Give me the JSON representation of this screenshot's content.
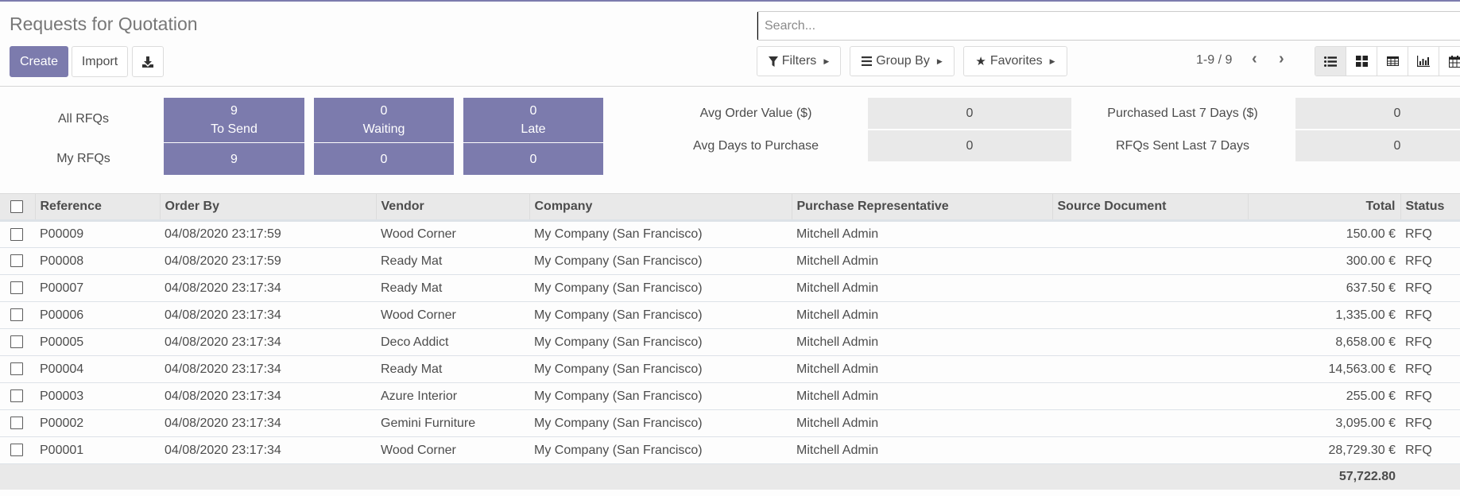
{
  "page": {
    "title": "Requests for Quotation",
    "accent_color": "#7c7bad"
  },
  "toolbar": {
    "create_label": "Create",
    "import_label": "Import",
    "download_icon": "download-icon"
  },
  "search": {
    "placeholder": "Search...",
    "value": ""
  },
  "filters": {
    "filters_label": "Filters",
    "group_by_label": "Group By",
    "favorites_label": "Favorites"
  },
  "pager": {
    "text": "1-9 / 9"
  },
  "views": [
    "list",
    "kanban",
    "pivot",
    "graph",
    "calendar"
  ],
  "dashboard": {
    "row_labels": [
      "All RFQs",
      "My RFQs"
    ],
    "tiles": [
      {
        "all_count": "9",
        "label": "To Send",
        "my_count": "9"
      },
      {
        "all_count": "0",
        "label": "Waiting",
        "my_count": "0"
      },
      {
        "all_count": "0",
        "label": "Late",
        "my_count": "0"
      }
    ],
    "stats": [
      {
        "label": "Avg Order Value ($)",
        "value": "0"
      },
      {
        "label": "Avg Days to Purchase",
        "value": "0"
      },
      {
        "label": "Purchased Last 7 Days ($)",
        "value": "0"
      },
      {
        "label": "RFQs Sent Last 7 Days",
        "value": "0"
      }
    ]
  },
  "table": {
    "columns": [
      "Reference",
      "Order By",
      "Vendor",
      "Company",
      "Purchase Representative",
      "Source Document",
      "Total",
      "Status"
    ],
    "rows": [
      {
        "reference": "P00009",
        "order_by": "04/08/2020 23:17:59",
        "vendor": "Wood Corner",
        "company": "My Company (San Francisco)",
        "rep": "Mitchell Admin",
        "source": "",
        "total": "150.00 €",
        "status": "RFQ"
      },
      {
        "reference": "P00008",
        "order_by": "04/08/2020 23:17:59",
        "vendor": "Ready Mat",
        "company": "My Company (San Francisco)",
        "rep": "Mitchell Admin",
        "source": "",
        "total": "300.00 €",
        "status": "RFQ"
      },
      {
        "reference": "P00007",
        "order_by": "04/08/2020 23:17:34",
        "vendor": "Ready Mat",
        "company": "My Company (San Francisco)",
        "rep": "Mitchell Admin",
        "source": "",
        "total": "637.50 €",
        "status": "RFQ"
      },
      {
        "reference": "P00006",
        "order_by": "04/08/2020 23:17:34",
        "vendor": "Wood Corner",
        "company": "My Company (San Francisco)",
        "rep": "Mitchell Admin",
        "source": "",
        "total": "1,335.00 €",
        "status": "RFQ"
      },
      {
        "reference": "P00005",
        "order_by": "04/08/2020 23:17:34",
        "vendor": "Deco Addict",
        "company": "My Company (San Francisco)",
        "rep": "Mitchell Admin",
        "source": "",
        "total": "8,658.00 €",
        "status": "RFQ"
      },
      {
        "reference": "P00004",
        "order_by": "04/08/2020 23:17:34",
        "vendor": "Ready Mat",
        "company": "My Company (San Francisco)",
        "rep": "Mitchell Admin",
        "source": "",
        "total": "14,563.00 €",
        "status": "RFQ"
      },
      {
        "reference": "P00003",
        "order_by": "04/08/2020 23:17:34",
        "vendor": "Azure Interior",
        "company": "My Company (San Francisco)",
        "rep": "Mitchell Admin",
        "source": "",
        "total": "255.00 €",
        "status": "RFQ"
      },
      {
        "reference": "P00002",
        "order_by": "04/08/2020 23:17:34",
        "vendor": "Gemini Furniture",
        "company": "My Company (San Francisco)",
        "rep": "Mitchell Admin",
        "source": "",
        "total": "3,095.00 €",
        "status": "RFQ"
      },
      {
        "reference": "P00001",
        "order_by": "04/08/2020 23:17:34",
        "vendor": "Wood Corner",
        "company": "My Company (San Francisco)",
        "rep": "Mitchell Admin",
        "source": "",
        "total": "28,729.30 €",
        "status": "RFQ"
      }
    ],
    "footer_total": "57,722.80"
  }
}
